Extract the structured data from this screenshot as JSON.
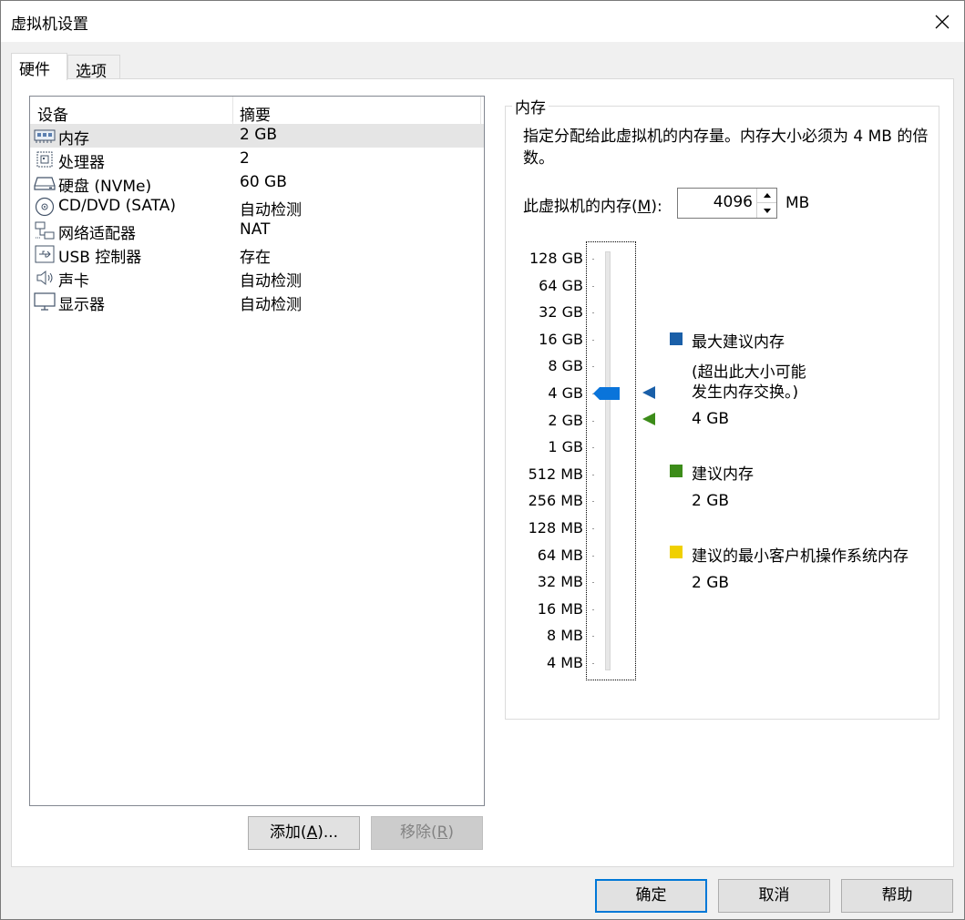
{
  "window": {
    "title": "虚拟机设置"
  },
  "tabs": [
    {
      "label": "硬件",
      "active": true
    },
    {
      "label": "选项",
      "active": false
    }
  ],
  "device_list": {
    "columns": [
      "设备",
      "摘要"
    ],
    "rows": [
      {
        "name": "内存",
        "summary": "2 GB",
        "icon": "memory-icon",
        "selected": true
      },
      {
        "name": "处理器",
        "summary": "2",
        "icon": "processor-icon",
        "selected": false
      },
      {
        "name": "硬盘 (NVMe)",
        "summary": "60 GB",
        "icon": "harddisk-icon",
        "selected": false
      },
      {
        "name": "CD/DVD (SATA)",
        "summary": "自动检测",
        "icon": "cd-dvd-icon",
        "selected": false
      },
      {
        "name": "网络适配器",
        "summary": "NAT",
        "icon": "network-adapter-icon",
        "selected": false
      },
      {
        "name": "USB 控制器",
        "summary": "存在",
        "icon": "usb-icon",
        "selected": false
      },
      {
        "name": "声卡",
        "summary": "自动检测",
        "icon": "sound-card-icon",
        "selected": false
      },
      {
        "name": "显示器",
        "summary": "自动检测",
        "icon": "display-icon",
        "selected": false
      }
    ]
  },
  "device_buttons": {
    "add_prefix": "添加(",
    "add_key": "A",
    "add_suffix": ")...",
    "remove_prefix": "移除(",
    "remove_key": "R",
    "remove_suffix": ")"
  },
  "memory": {
    "group_title": "内存",
    "description": "指定分配给此虚拟机的内存量。内存大小必须为 4 MB 的倍数。",
    "label_prefix": "此虚拟机的内存(",
    "label_key": "M",
    "label_suffix": "):",
    "value": "4096",
    "unit": "MB",
    "slider_ticks": [
      "128 GB",
      "64 GB",
      "32 GB",
      "16 GB",
      "8 GB",
      "4 GB",
      "2 GB",
      "1 GB",
      "512 MB",
      "256 MB",
      "128 MB",
      "64 MB",
      "32 MB",
      "16 MB",
      "8 MB",
      "4 MB"
    ],
    "slider_value": "4 GB",
    "legend": {
      "max": {
        "title": "最大建议内存",
        "note_line1": "(超出此大小可能",
        "note_line2": "发生内存交换。)",
        "value": "4 GB",
        "color": "#1a5fa8"
      },
      "recommended": {
        "title": "建议内存",
        "value": "2 GB",
        "color": "#3c8c19"
      },
      "min": {
        "title": "建议的最小客户机操作系统内存",
        "value": "2 GB",
        "color": "#f0d000"
      }
    }
  },
  "footer": {
    "ok": "确定",
    "cancel": "取消",
    "help": "帮助"
  }
}
